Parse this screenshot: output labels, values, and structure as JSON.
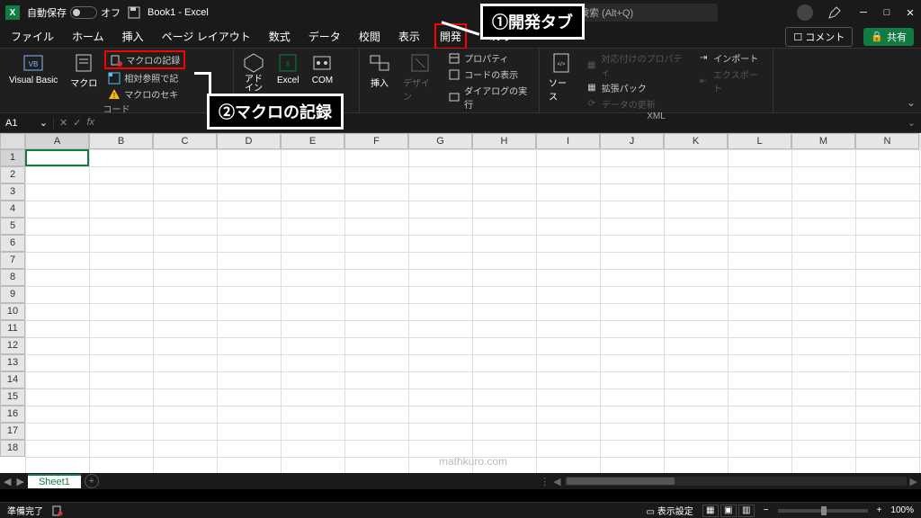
{
  "titlebar": {
    "autosave_label": "自動保存",
    "autosave_state": "オフ",
    "document": "Book1 - Excel",
    "search_placeholder": "検索 (Alt+Q)"
  },
  "tabs": {
    "items": [
      "ファイル",
      "ホーム",
      "挿入",
      "ページ レイアウト",
      "数式",
      "データ",
      "校閲",
      "表示",
      "開発",
      "ヘルプ"
    ],
    "active_index": 8,
    "comment": "コメント",
    "share": "共有"
  },
  "ribbon": {
    "code": {
      "visual_basic": "Visual Basic",
      "macros": "マクロ",
      "record_macro": "マクロの記録",
      "relative_ref": "相対参照で記",
      "macro_security": "マクロのセキ",
      "group_label": "コード"
    },
    "addins": {
      "addins": "アド\nイン",
      "excel": "Excel",
      "com": "COM",
      "group_label": ""
    },
    "controls": {
      "insert": "挿入",
      "design": "デザイン",
      "properties": "プロパティ",
      "view_code": "コードの表示",
      "run_dialog": "ダイアログの実行",
      "group_label": ""
    },
    "xml": {
      "source": "ソース",
      "map_props": "対応付けのプロパティ",
      "expansion": "拡張パック",
      "refresh": "データの更新",
      "import": "インポート",
      "export": "エクスポート",
      "group_label": "XML"
    }
  },
  "namebox": {
    "value": "A1"
  },
  "columns": [
    "A",
    "B",
    "C",
    "D",
    "E",
    "F",
    "G",
    "H",
    "I",
    "J",
    "K",
    "L",
    "M",
    "N"
  ],
  "rows": [
    "1",
    "2",
    "3",
    "4",
    "5",
    "6",
    "7",
    "8",
    "9",
    "10",
    "11",
    "12",
    "13",
    "14",
    "15",
    "16",
    "17",
    "18"
  ],
  "sheet": {
    "name": "Sheet1"
  },
  "statusbar": {
    "ready": "準備完了",
    "display_settings": "表示設定",
    "zoom": "100%"
  },
  "callouts": {
    "c1": "①開発タブ",
    "c2": "②マクロの記録"
  },
  "watermark": "mathkuro.com"
}
